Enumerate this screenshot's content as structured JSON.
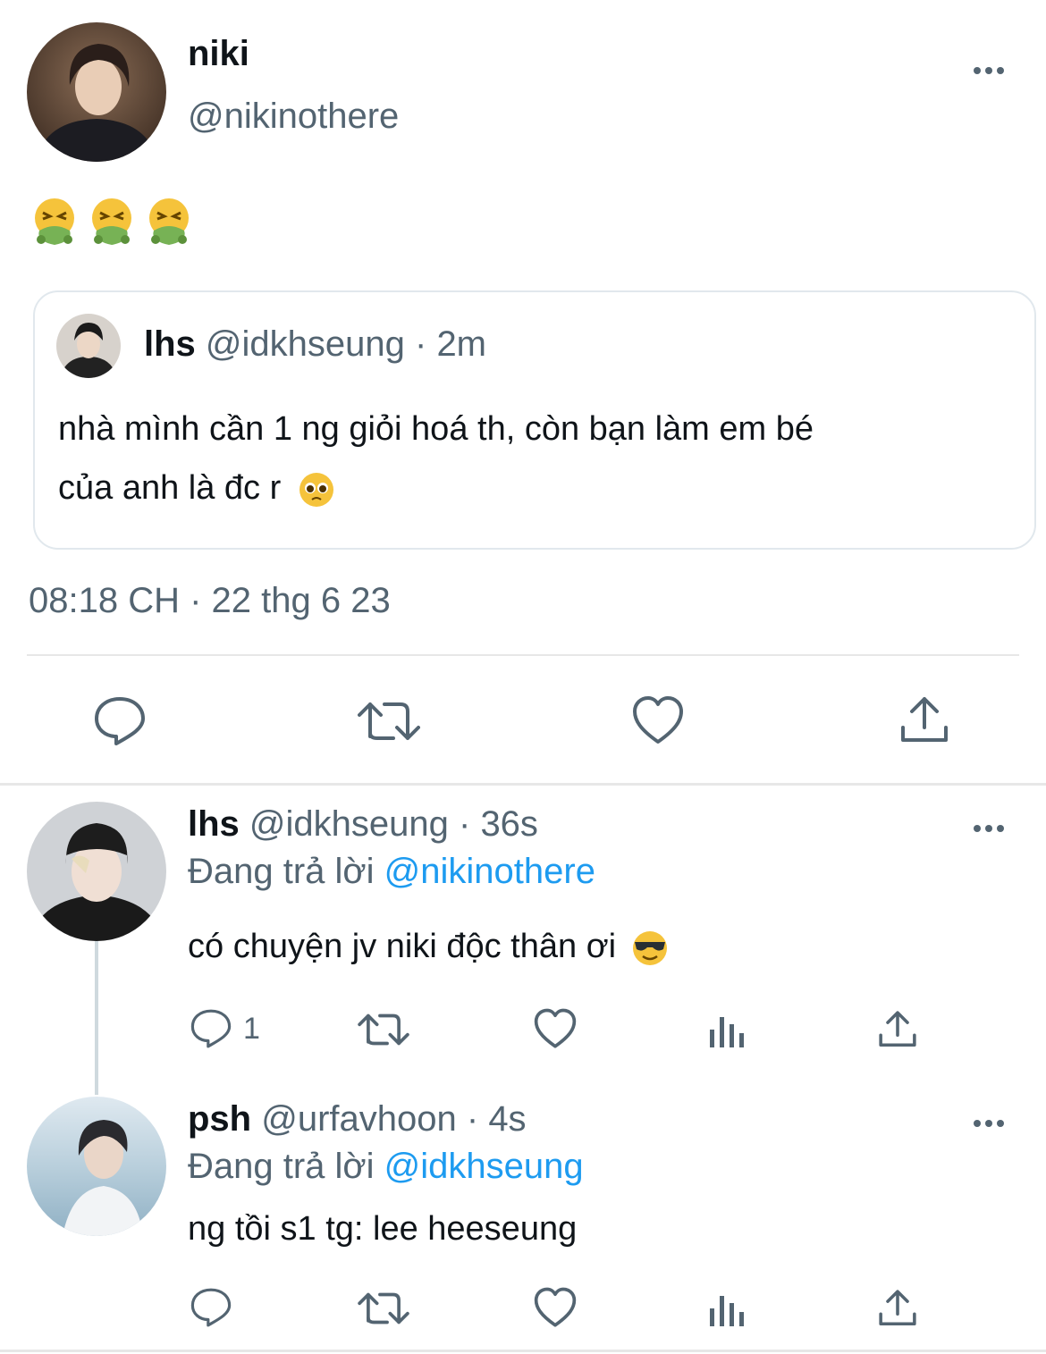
{
  "main_tweet": {
    "name": "niki",
    "handle": "@nikinothere",
    "emojis": [
      "nauseated-face",
      "nauseated-face",
      "nauseated-face"
    ],
    "timestamp": "08:18 CH · 22 thg 6 23",
    "quote": {
      "name": "lhs",
      "handle_time": "@idkhseung · 2m",
      "text_line1": "nhà mình cần 1 ng giỏi hoá th, còn bạn làm em bé",
      "text_line2": "của anh là đc r",
      "emoji": "pleading-face"
    }
  },
  "replies": [
    {
      "name": "lhs",
      "handle_time": "@idkhseung · 36s",
      "replying_label": "Đang trả lời",
      "replying_to": "@nikinothere",
      "text": "có chuyện jv niki độc thân ơi",
      "emoji": "smiling-face-with-sunglasses",
      "reply_count": "1"
    },
    {
      "name": "psh",
      "handle_time": "@urfavhoon · 4s",
      "replying_label": "Đang trả lời",
      "replying_to": "@idkhseung",
      "text": "ng tồi s1 tg: lee heeseung",
      "reply_count": ""
    }
  ],
  "colors": {
    "accent": "#1d9bf0",
    "secondary_text": "#536471",
    "icon": "#536471"
  }
}
